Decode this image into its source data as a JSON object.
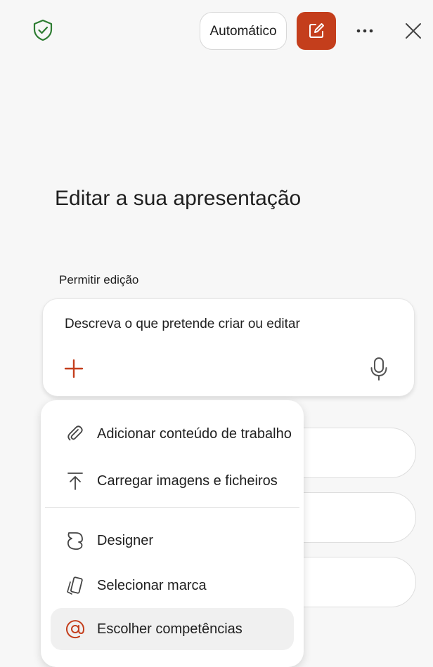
{
  "header": {
    "mode_label": "Automático",
    "icons": [
      "shield-check-icon",
      "new-chat-icon",
      "more-icon",
      "close-icon"
    ],
    "accent_color": "#c43e1c",
    "shield_color": "#2e7d32"
  },
  "main": {
    "title": "Editar a sua apresentação",
    "permission_label": "Permitir edição",
    "prompt": {
      "placeholder": "Descreva o que pretende criar ou editar"
    }
  },
  "menu": {
    "items": [
      {
        "label": "Adicionar conteúdo de trabalho",
        "icon": "paperclip-icon"
      },
      {
        "label": "Carregar imagens e ficheiros",
        "icon": "upload-icon"
      },
      {
        "label": "Designer",
        "icon": "designer-icon"
      },
      {
        "label": "Selecionar marca",
        "icon": "brand-icon"
      },
      {
        "label": "Escolher competências",
        "icon": "at-icon"
      }
    ]
  }
}
